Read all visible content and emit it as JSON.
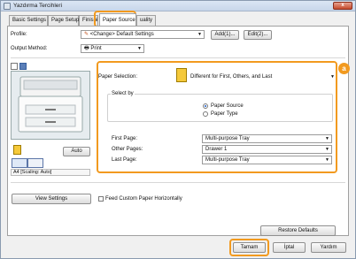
{
  "window": {
    "title": "Yazdırma Tercihleri",
    "close_label": "x"
  },
  "tabs": [
    {
      "label": "Basic Settings"
    },
    {
      "label": "Page Setup"
    },
    {
      "label": "Finishin"
    },
    {
      "label": "Paper Source"
    },
    {
      "label": "uality"
    }
  ],
  "profile": {
    "label": "Profile:",
    "value": "<Change> Default Settings",
    "add_label": "Add(1)...",
    "edit_label": "Edit(2)..."
  },
  "output": {
    "label": "Output Method:",
    "value": "Print"
  },
  "preview": {
    "auto_label": "Auto",
    "scaling_text": "A4 [Scaling: Auto]"
  },
  "paper_selection": {
    "label": "Paper Selection:",
    "value": "Different for First, Others, and Last"
  },
  "select_by": {
    "label": "Select by",
    "options": [
      "Paper Source",
      "Paper Type"
    ],
    "selected": "Paper Source"
  },
  "pages": {
    "first_label": "First Page:",
    "first_value": "Multi-purpose Tray",
    "other_label": "Other Pages:",
    "other_value": "Drawer 1",
    "last_label": "Last Page:",
    "last_value": "Multi-purpose Tray"
  },
  "bottom": {
    "view_settings_label": "View Settings",
    "feed_custom_label": "Feed Custom Paper Horizontally",
    "restore_label": "Restore Defaults"
  },
  "dialog_buttons": {
    "ok_label": "Tamam",
    "cancel_label": "İptal",
    "help_label": "Yardım"
  },
  "callout": {
    "badge_label": "a"
  },
  "colors": {
    "highlight": "#f29a1f",
    "accent": "#1b5ec7"
  }
}
